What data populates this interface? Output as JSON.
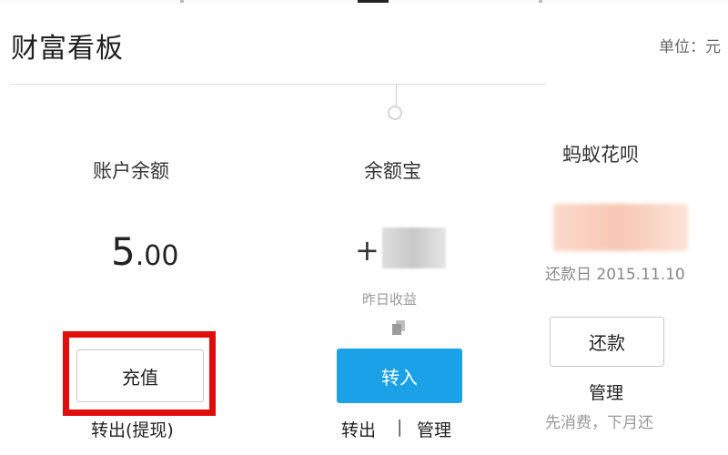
{
  "header": {
    "title": "财富看板",
    "unit": "单位：元"
  },
  "account_balance": {
    "title": "账户余额",
    "amount_int": "5",
    "amount_dec": ".00",
    "recharge_button": "充值",
    "withdraw_link": "转出(提现)"
  },
  "yuebao": {
    "title": "余额宝",
    "plus": "+",
    "yesterday_earnings_label": "昨日收益",
    "transfer_in_button": "转入",
    "transfer_out_link": "转出",
    "separator": "|",
    "manage_link": "管理"
  },
  "huabei": {
    "title": "蚂蚁花呗",
    "repay_date": "还款日 2015.11.10",
    "repay_button": "还款",
    "manage_link": "管理",
    "note": "先消费，下月还"
  },
  "colors": {
    "highlight": "#e10c0c",
    "primary_button": "#1aa1e8"
  }
}
